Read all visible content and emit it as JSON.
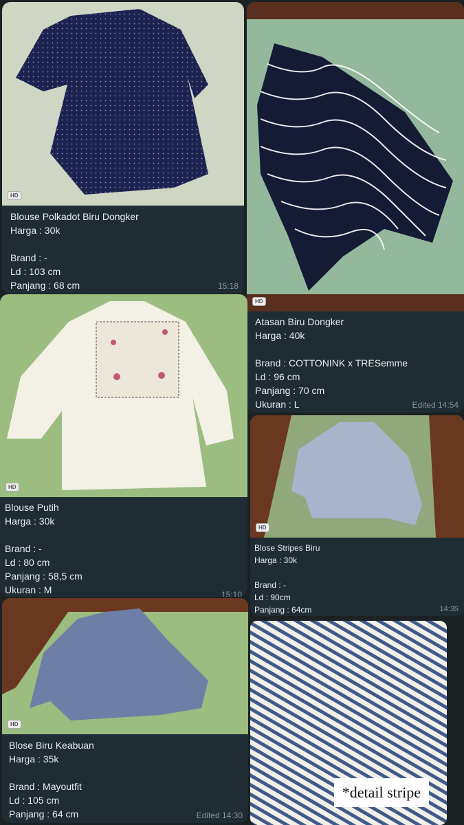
{
  "hd_label": "HD",
  "cards": [
    {
      "title": "Blouse Polkadot Biru Dongker",
      "price": "Harga : 30k",
      "brand": "Brand : -",
      "ld": "Ld : 103 cm",
      "length": "Panjang : 68 cm",
      "time": "15:18"
    },
    {
      "title": "Atasan Biru Dongker",
      "price": "Harga : 40k",
      "brand": "Brand : COTTONINK x TRESemme",
      "ld": "Ld : 96 cm",
      "length": "Panjang : 70 cm",
      "size": "Ukuran : L",
      "time": "Edited 14:54"
    },
    {
      "title": "Blouse Putih",
      "price": "Harga : 30k",
      "brand": "Brand : -",
      "ld": "Ld : 80 cm",
      "length": "Panjang : 58,5 cm",
      "size": "Ukuran : M",
      "time": "15:10"
    },
    {
      "title": "Blose Stripes Biru",
      "price": "Harga : 30k",
      "brand": "Brand : -",
      "ld": "Ld : 90cm",
      "length": "Panjang : 64cm",
      "time": "14:35"
    },
    {
      "title": "Blose Biru Keabuan",
      "price": "Harga : 35k",
      "brand": "Brand : Mayoutfit",
      "ld": "Ld : 105 cm",
      "length": "Panjang : 64 cm",
      "time": "Edited 14:30"
    }
  ],
  "detail_label": "*detail stripe"
}
